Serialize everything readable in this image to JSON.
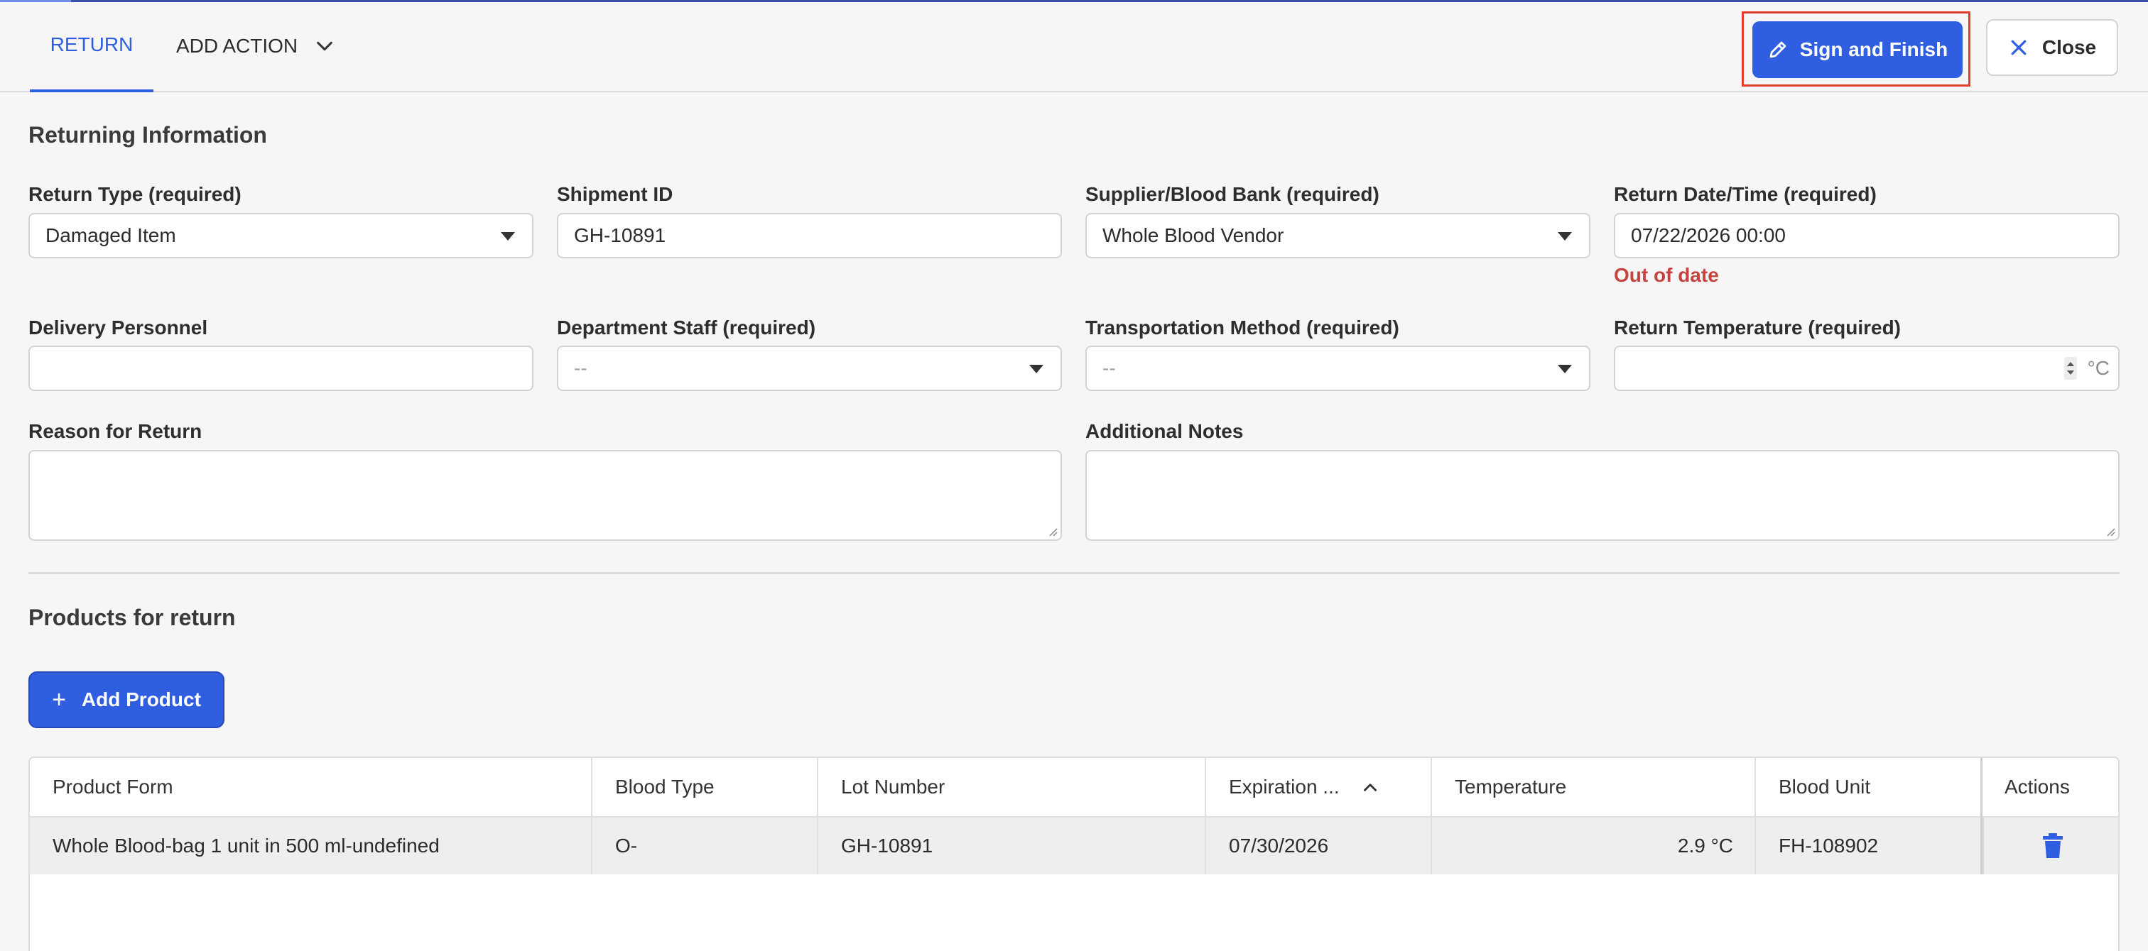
{
  "header": {
    "tabs": [
      {
        "label": "RETURN",
        "active": true
      },
      {
        "label": "ADD ACTION",
        "active": false
      }
    ],
    "sign_finish_label": "Sign and Finish",
    "close_label": "Close",
    "accent_color": "#2f5fe0"
  },
  "returning_info": {
    "title": "Returning Information",
    "return_type": {
      "label": "Return Type (required)",
      "value": "Damaged Item"
    },
    "shipment_id": {
      "label": "Shipment ID",
      "value": "GH-10891"
    },
    "supplier": {
      "label": "Supplier/Blood Bank (required)",
      "value": "Whole Blood Vendor"
    },
    "return_datetime": {
      "label": "Return Date/Time (required)",
      "value": "07/22/2026 00:00",
      "error": "Out of date"
    },
    "delivery_personnel": {
      "label": "Delivery Personnel",
      "value": ""
    },
    "department_staff": {
      "label": "Department Staff (required)",
      "value": "--"
    },
    "transport_method": {
      "label": "Transportation Method (required)",
      "value": "--"
    },
    "return_temperature": {
      "label": "Return Temperature (required)",
      "value": "",
      "unit": "°C"
    },
    "reason": {
      "label": "Reason for Return",
      "value": ""
    },
    "notes": {
      "label": "Additional Notes",
      "value": ""
    }
  },
  "products": {
    "title": "Products for return",
    "add_button_label": "Add Product",
    "columns": [
      "Product Form",
      "Blood Type",
      "Lot Number",
      "Expiration ...",
      "Temperature",
      "Blood Unit",
      "Actions"
    ],
    "rows": [
      {
        "product_form": "Whole Blood-bag 1 unit in 500 ml-undefined",
        "blood_type": "O-",
        "lot_number": "GH-10891",
        "expiration": "07/30/2026",
        "temperature": "2.9 °C",
        "blood_unit": "FH-108902"
      }
    ]
  }
}
